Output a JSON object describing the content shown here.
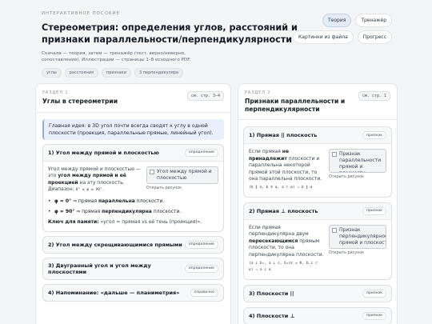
{
  "header": {
    "kicker": "ИНТЕРАКТИВНОЕ ПОСОБИЕ",
    "title": "Стереометрия: определения углов, расстояний и признаки параллельности/перпендикулярности",
    "subtitle": "Сначала — теория, затем — тренажёр (тест, верно/неверно, сопоставление). Иллюстрации — страницы 1–8 исходного PDF.",
    "tags": [
      "углы",
      "расстояния",
      "признаки",
      "3 перпендикуляра"
    ]
  },
  "nav": {
    "theory": "Теория",
    "trainer": "Тренажёр",
    "pictures": "Картинки из файла",
    "progress": "Прогресс"
  },
  "left": {
    "section_label": "РАЗДЕЛ 1",
    "section_title": "Углы в стереометрии",
    "pages": "см. стр. 3–4",
    "idea": "Главная идея: в 3D угол почти всегда сводят к углу в одной плоскости (проекция, параллельные прямые, линейный угол).",
    "card1": {
      "title": "1) Угол между прямой и плоскостью",
      "badge": "определение",
      "p1": "Угол между прямой и плоскостью — это ",
      "p1_b1": "угол между прямой и её проекцией",
      "p1_tail": " на эту плоскость.",
      "range_label": "Диапазон: ",
      "range": "0° ≤ φ ≤ 90°.",
      "b1_bold": "φ = 0°",
      "b1_mid": " ⇒ прямая ",
      "b1_bold2": "параллельна",
      "b1_tail": " плоскости.",
      "b2_bold": "φ = 90°",
      "b2_mid": " ⇒ прямая ",
      "b2_bold2": "перпендикулярна",
      "b2_tail": " плоскости.",
      "memo_bold": "Ключ для памяти:",
      "memo_tail": " «угол = прямая vs её тень (проекция)».",
      "img_alt": "Угол между прямой и плоскостью",
      "open": "Открыть рисунок"
    },
    "card2": {
      "title": "2) Угол между скрещивающимися прямыми",
      "badge": "определение"
    },
    "card3": {
      "title": "3) Двугранный угол и угол между плоскостями",
      "badge": "определение"
    },
    "card4": {
      "title": "4) Напоминание: «дальше — планиметрия»",
      "badge": "справочно"
    }
  },
  "right": {
    "section_label": "РАЗДЕЛ 2",
    "section_title": "Признаки параллельности и перпендикулярности",
    "pages": "см. стр. 1",
    "card1": {
      "title": "1) Прямая || плоскость",
      "badge": "признак",
      "t1": "Если прямая ",
      "t1_b": "не принадлежит",
      "t1_tail": " плоскости и параллельна некоторой прямой этой плоскости, то она параллельна плоскости.",
      "formula": "(b ∥ a, b ⊄ α, a ⊂ α) ⇒ b ∥ α",
      "img_alt": "Признак параллельности прямой и плоскости",
      "open": "Открыть рисунок"
    },
    "card2": {
      "title": "2) Прямая ⊥ плоскость",
      "badge": "признак",
      "t1": "Если прямая перпендикулярна двум ",
      "t1_b": "пересекающимся",
      "t1_tail": " прямым плоскости, то она перпендикулярна плоскости.",
      "formula": "(a ⊥ b₁, a ⊥ c, b₁∩c = K, b,c ⊂ α) ⇒ a ⊥ α",
      "img_alt": "Признак перпендикулярности прямой и плоскости",
      "open": "Открыть рисунок"
    },
    "card3": {
      "title": "3) Плоскости ||",
      "badge": "признак"
    },
    "card4": {
      "title": "4) Плоскости ⊥",
      "badge": "признак"
    }
  }
}
